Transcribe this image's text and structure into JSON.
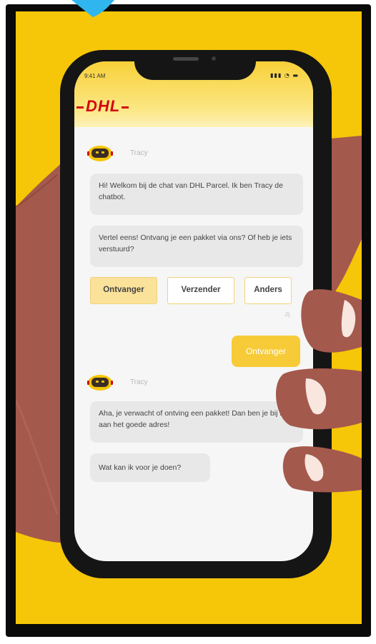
{
  "status_bar": {
    "time": "9:41 AM",
    "icons": "signal-wifi-battery"
  },
  "header": {
    "logo_text": "DHL"
  },
  "chat": {
    "bot_name": "Tracy",
    "messages": [
      {
        "from": "bot",
        "text": "Hi! Welkom bij de chat van DHL Parcel. Ik ben Tracy de chatbot."
      },
      {
        "from": "bot",
        "text": "Vertel eens! Ontvang je een pakket via ons? Of heb je iets verstuurd?"
      }
    ],
    "choices": [
      {
        "label": "Ontvanger",
        "selected": true
      },
      {
        "label": "Verzender",
        "selected": false
      },
      {
        "label": "Anders",
        "selected": false
      }
    ],
    "user_label": "Jij",
    "user_reply": "Ontvanger",
    "bot_name_2": "Tracy",
    "messages_2": [
      {
        "from": "bot",
        "text": "Aha, je verwacht of ontving een pakket! Dan ben je bij mij aan het goede adres!"
      },
      {
        "from": "bot",
        "text": "Wat kan ik voor je doen?"
      }
    ]
  },
  "colors": {
    "background_yellow": "#f6c608",
    "dhl_red": "#d40511",
    "bubble_grey": "#e8e8e8",
    "user_bubble_yellow": "#f7cb38",
    "choice_selected": "#fbe29a",
    "skin": "#a4594d"
  }
}
